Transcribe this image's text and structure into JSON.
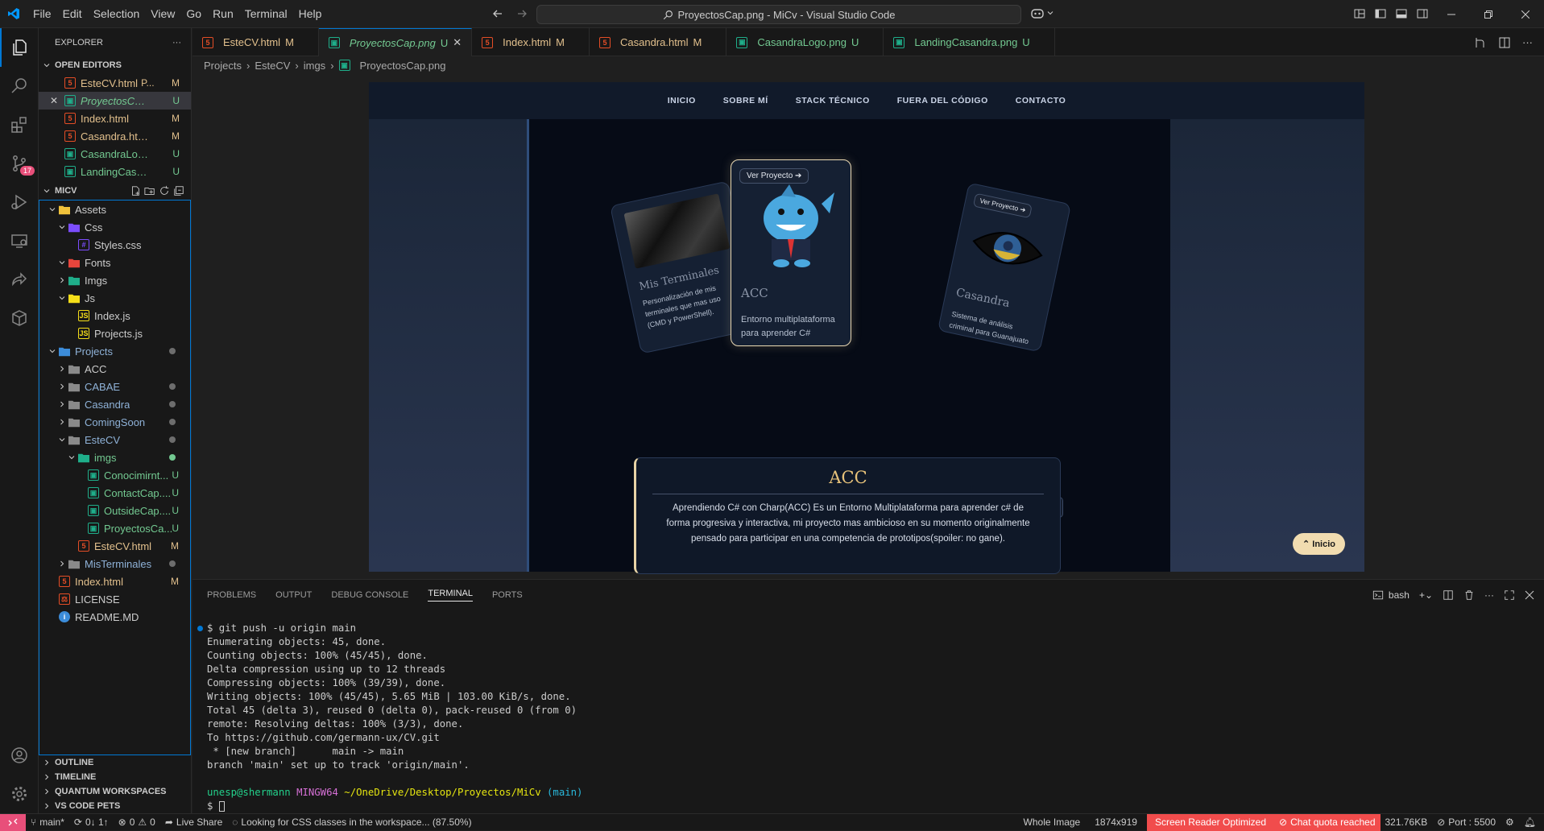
{
  "window": {
    "title": "ProyectosCap.png - MiCv - Visual Studio Code",
    "menu": [
      "File",
      "Edit",
      "Selection",
      "View",
      "Go",
      "Run",
      "Terminal",
      "Help"
    ]
  },
  "activity": {
    "scm_badge": "17"
  },
  "sidebar": {
    "header": "EXPLORER",
    "open_editors_title": "OPEN EDITORS",
    "open_editors": [
      {
        "name": "EsteCV.html",
        "extra": "P...",
        "status": "M",
        "icon": "html"
      },
      {
        "name": "ProyectosCap.p...",
        "status": "U",
        "icon": "img",
        "selected": true,
        "closable": true
      },
      {
        "name": "Index.html",
        "status": "M",
        "icon": "html"
      },
      {
        "name": "Casandra.html...",
        "status": "M",
        "icon": "html"
      },
      {
        "name": "CasandraLogo....",
        "status": "U",
        "icon": "img"
      },
      {
        "name": "LandingCasan...",
        "status": "U",
        "icon": "img"
      }
    ],
    "workspace_title": "MICV",
    "tree": [
      {
        "name": "Assets",
        "depth": 0,
        "type": "folder",
        "open": true
      },
      {
        "name": "Css",
        "depth": 1,
        "type": "folder",
        "open": true
      },
      {
        "name": "Styles.css",
        "depth": 2,
        "type": "css"
      },
      {
        "name": "Fonts",
        "depth": 1,
        "type": "folder",
        "open": true
      },
      {
        "name": "Imgs",
        "depth": 1,
        "type": "folder",
        "open": false
      },
      {
        "name": "Js",
        "depth": 1,
        "type": "folder",
        "open": true
      },
      {
        "name": "Index.js",
        "depth": 2,
        "type": "js"
      },
      {
        "name": "Projects.js",
        "depth": 2,
        "type": "js"
      },
      {
        "name": "Projects",
        "depth": 0,
        "type": "folder",
        "open": true,
        "dot": true
      },
      {
        "name": "ACC",
        "depth": 1,
        "type": "folder",
        "open": false
      },
      {
        "name": "CABAE",
        "depth": 1,
        "type": "folder",
        "open": false,
        "dot": true
      },
      {
        "name": "Casandra",
        "depth": 1,
        "type": "folder",
        "open": false,
        "dot": true
      },
      {
        "name": "ComingSoon",
        "depth": 1,
        "type": "folder",
        "open": false,
        "dot": true
      },
      {
        "name": "EsteCV",
        "depth": 1,
        "type": "folder",
        "open": true,
        "dot": true
      },
      {
        "name": "imgs",
        "depth": 2,
        "type": "folder",
        "open": true,
        "dot": true,
        "color": "unt"
      },
      {
        "name": "Conocimirnt...",
        "depth": 3,
        "type": "img",
        "status": "U"
      },
      {
        "name": "ContactCap....",
        "depth": 3,
        "type": "img",
        "status": "U"
      },
      {
        "name": "OutsideCap....",
        "depth": 3,
        "type": "img",
        "status": "U"
      },
      {
        "name": "ProyectosCa...",
        "depth": 3,
        "type": "img",
        "status": "U"
      },
      {
        "name": "EsteCV.html",
        "depth": 2,
        "type": "html",
        "status": "M"
      },
      {
        "name": "MisTerminales",
        "depth": 1,
        "type": "folder",
        "open": false,
        "dot": true
      },
      {
        "name": "Index.html",
        "depth": 0,
        "type": "html",
        "status": "M"
      },
      {
        "name": "LICENSE",
        "depth": 0,
        "type": "license"
      },
      {
        "name": "README.MD",
        "depth": 0,
        "type": "info"
      }
    ],
    "bottom_sections": [
      "OUTLINE",
      "TIMELINE",
      "QUANTUM WORKSPACES",
      "VS CODE PETS"
    ]
  },
  "tabs": [
    {
      "name": "EsteCV.html",
      "status": "M",
      "icon": "html"
    },
    {
      "name": "ProyectosCap.png",
      "status": "U",
      "icon": "img",
      "active": true
    },
    {
      "name": "Index.html",
      "status": "M",
      "icon": "html"
    },
    {
      "name": "Casandra.html",
      "status": "M",
      "icon": "html"
    },
    {
      "name": "CasandraLogo.png",
      "status": "U",
      "icon": "img"
    },
    {
      "name": "LandingCasandra.png",
      "status": "U",
      "icon": "img"
    }
  ],
  "breadcrumb": [
    "Projects",
    "EsteCV",
    "imgs",
    "ProyectosCap.png"
  ],
  "site": {
    "nav": [
      "INICIO",
      "SOBRE MÍ",
      "STACK TÉCNICO",
      "FUERA DEL CÓDIGO",
      "CONTACTO"
    ],
    "cards": {
      "left": {
        "title": "Mis Terminales",
        "desc": "Personalización de mis terminales que mas uso (CMD y PowerShell)."
      },
      "center": {
        "button": "Ver Proyecto",
        "title": "ACC",
        "desc": "Entorno multiplataforma para aprender C#"
      },
      "right": {
        "button": "Ver Proyecto",
        "title": "Casandra",
        "desc": "Sistema de análisis criminal para Guanajuato"
      }
    },
    "detail": {
      "title": "ACC",
      "text": "Aprendiendo C# con Charp(ACC) Es un Entorno Multiplataforma para aprender c# de forma progresiva y interactiva, mi proyecto mas ambicioso en su momento originalmente pensado para participar en una competencia de prototipos(spoiler: no gane)."
    },
    "inicio_button": "Inicio"
  },
  "panel": {
    "tabs": [
      "PROBLEMS",
      "OUTPUT",
      "DEBUG CONSOLE",
      "TERMINAL",
      "PORTS"
    ],
    "active_tab": "TERMINAL",
    "shell": "bash",
    "terminal_lines": [
      "$ git push -u origin main",
      "Enumerating objects: 45, done.",
      "Counting objects: 100% (45/45), done.",
      "Delta compression using up to 12 threads",
      "Compressing objects: 100% (39/39), done.",
      "Writing objects: 100% (45/45), 5.65 MiB | 103.00 KiB/s, done.",
      "Total 45 (delta 3), reused 0 (delta 0), pack-reused 0 (from 0)",
      "remote: Resolving deltas: 100% (3/3), done.",
      "To https://github.com/germann-ux/CV.git",
      " * [new branch]      main -> main",
      "branch 'main' set up to track 'origin/main'.",
      ""
    ],
    "prompt": {
      "user": "unesp@shermann",
      "sys": "MINGW64",
      "path": "~/OneDrive/Desktop/Proyectos/MiCv",
      "branch": "(main)",
      "cursor": "$ "
    }
  },
  "status": {
    "branch": "main*",
    "sync": "0↓ 1↑",
    "errors": "0",
    "warnings": "0",
    "liveshare": "Live Share",
    "task": "Looking for CSS classes in the workspace... (87.50%)",
    "image_mode": "Whole Image",
    "dims": "1874x919",
    "screen_reader": "Screen Reader Optimized",
    "chat": "Chat quota reached",
    "size": "321.76KB",
    "port": "Port : 5500"
  },
  "colors": {
    "accent": "#0078d4",
    "modified": "#e2c08d",
    "untracked": "#73c991",
    "remote": "#e84f7a",
    "gold": "#e7c27a"
  }
}
